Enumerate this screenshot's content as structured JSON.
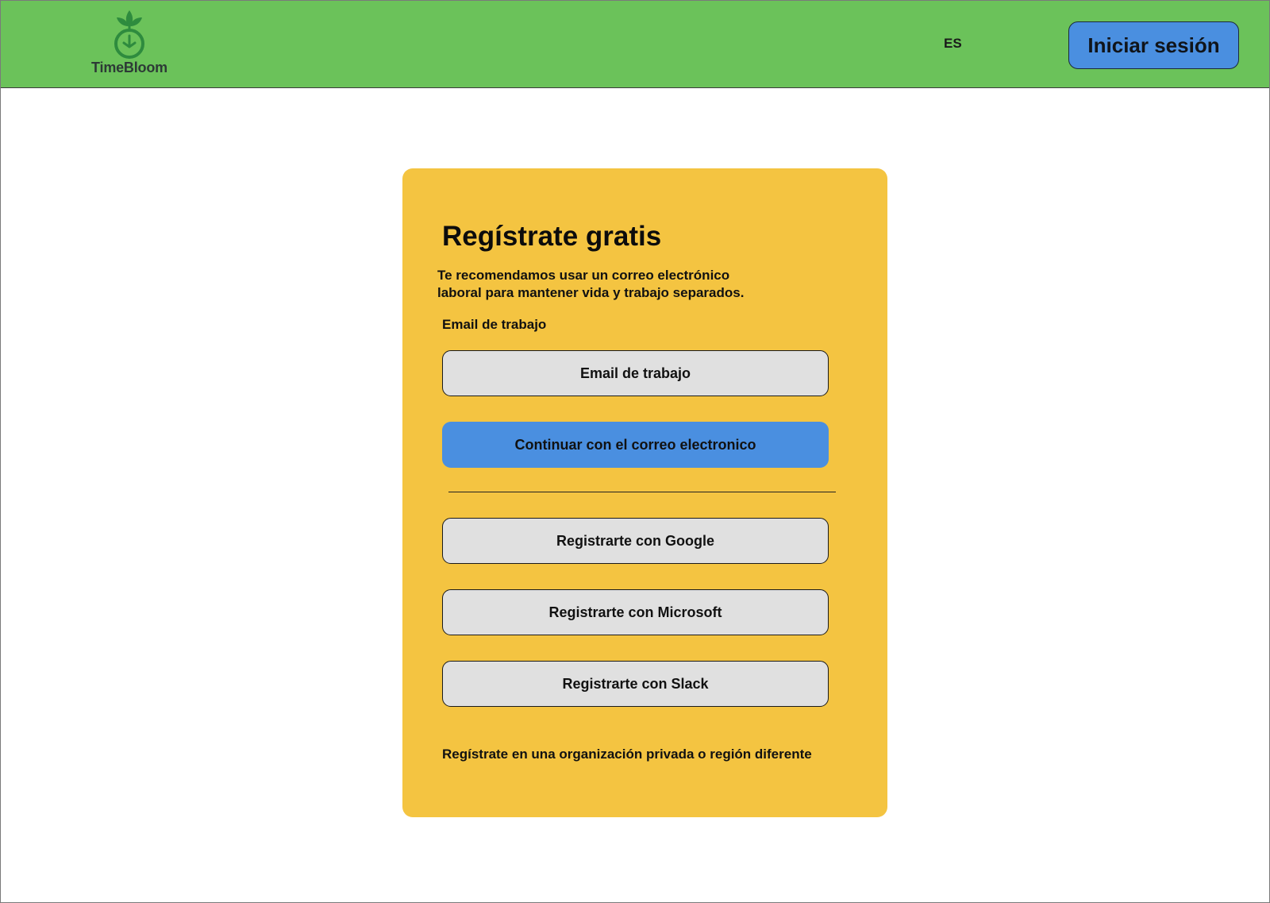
{
  "header": {
    "brand": "TimeBloom",
    "language": "ES",
    "login_label": "Iniciar sesión"
  },
  "signup": {
    "title": "Regístrate gratis",
    "subtitle_line1": "Te recomendamos usar un correo electrónico",
    "subtitle_line2": "laboral para mantener vida y trabajo separados.",
    "email_label": "Email de trabajo",
    "email_placeholder": "Email de trabajo",
    "continue_label": "Continuar con el  correo  electronico",
    "google_label": "Registrarte con Google",
    "microsoft_label": "Registrarte con Microsoft",
    "slack_label": "Registrarte con Slack",
    "private_org_link": "Regístrate en una organización privada o región diferente"
  },
  "colors": {
    "header_bg": "#6bc25a",
    "card_bg": "#f4c441",
    "primary_blue": "#4a8fe0",
    "secondary_button_bg": "#e0e0e0",
    "logo_green": "#2e8b3e"
  },
  "icons": {
    "logo": "sprout-clock-icon"
  }
}
